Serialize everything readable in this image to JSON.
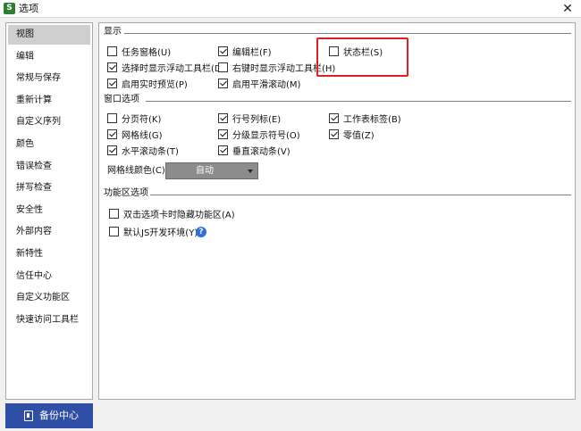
{
  "window": {
    "app_icon_letter": "S",
    "title": "选项",
    "close_glyph": "✕"
  },
  "sidebar": {
    "items": [
      {
        "label": "视图",
        "selected": true
      },
      {
        "label": "编辑"
      },
      {
        "label": "常规与保存"
      },
      {
        "label": "重新计算"
      },
      {
        "label": "自定义序列"
      },
      {
        "label": "颜色"
      },
      {
        "label": "错误检查"
      },
      {
        "label": "拼写检查"
      },
      {
        "label": "安全性"
      },
      {
        "label": "外部内容"
      },
      {
        "label": "新特性"
      },
      {
        "label": "信任中心"
      },
      {
        "label": "自定义功能区"
      },
      {
        "label": "快速访问工具栏"
      }
    ],
    "backup_button": "备份中心"
  },
  "display_section": {
    "title": "显示",
    "options": [
      {
        "label": "任务窗格(U)",
        "checked": false
      },
      {
        "label": "编辑栏(F)",
        "checked": true
      },
      {
        "label": "状态栏(S)",
        "checked": false
      },
      {
        "label": "选择时显示浮动工具栏(D)",
        "checked": true
      },
      {
        "label": "右键时显示浮动工具栏(H)",
        "checked": false
      },
      {
        "label": "启用实时预览(P)",
        "checked": true
      },
      {
        "label": "启用平滑滚动(M)",
        "checked": true
      }
    ]
  },
  "window_section": {
    "title": "窗口选项",
    "options": [
      {
        "label": "分页符(K)",
        "checked": false
      },
      {
        "label": "行号列标(E)",
        "checked": true
      },
      {
        "label": "工作表标签(B)",
        "checked": true
      },
      {
        "label": "网格线(G)",
        "checked": true
      },
      {
        "label": "分级显示符号(O)",
        "checked": true
      },
      {
        "label": "零值(Z)",
        "checked": true
      },
      {
        "label": "水平滚动条(T)",
        "checked": true
      },
      {
        "label": "垂直滚动条(V)",
        "checked": true
      }
    ],
    "gridline_color_label": "网格线颜色(C):",
    "gridline_color_value": "自动"
  },
  "ribbon_section": {
    "title": "功能区选项",
    "options": [
      {
        "label": "双击选项卡时隐藏功能区(A)",
        "checked": false
      },
      {
        "label": "默认JS开发环境(Y)",
        "checked": false
      }
    ],
    "help_glyph": "?"
  }
}
